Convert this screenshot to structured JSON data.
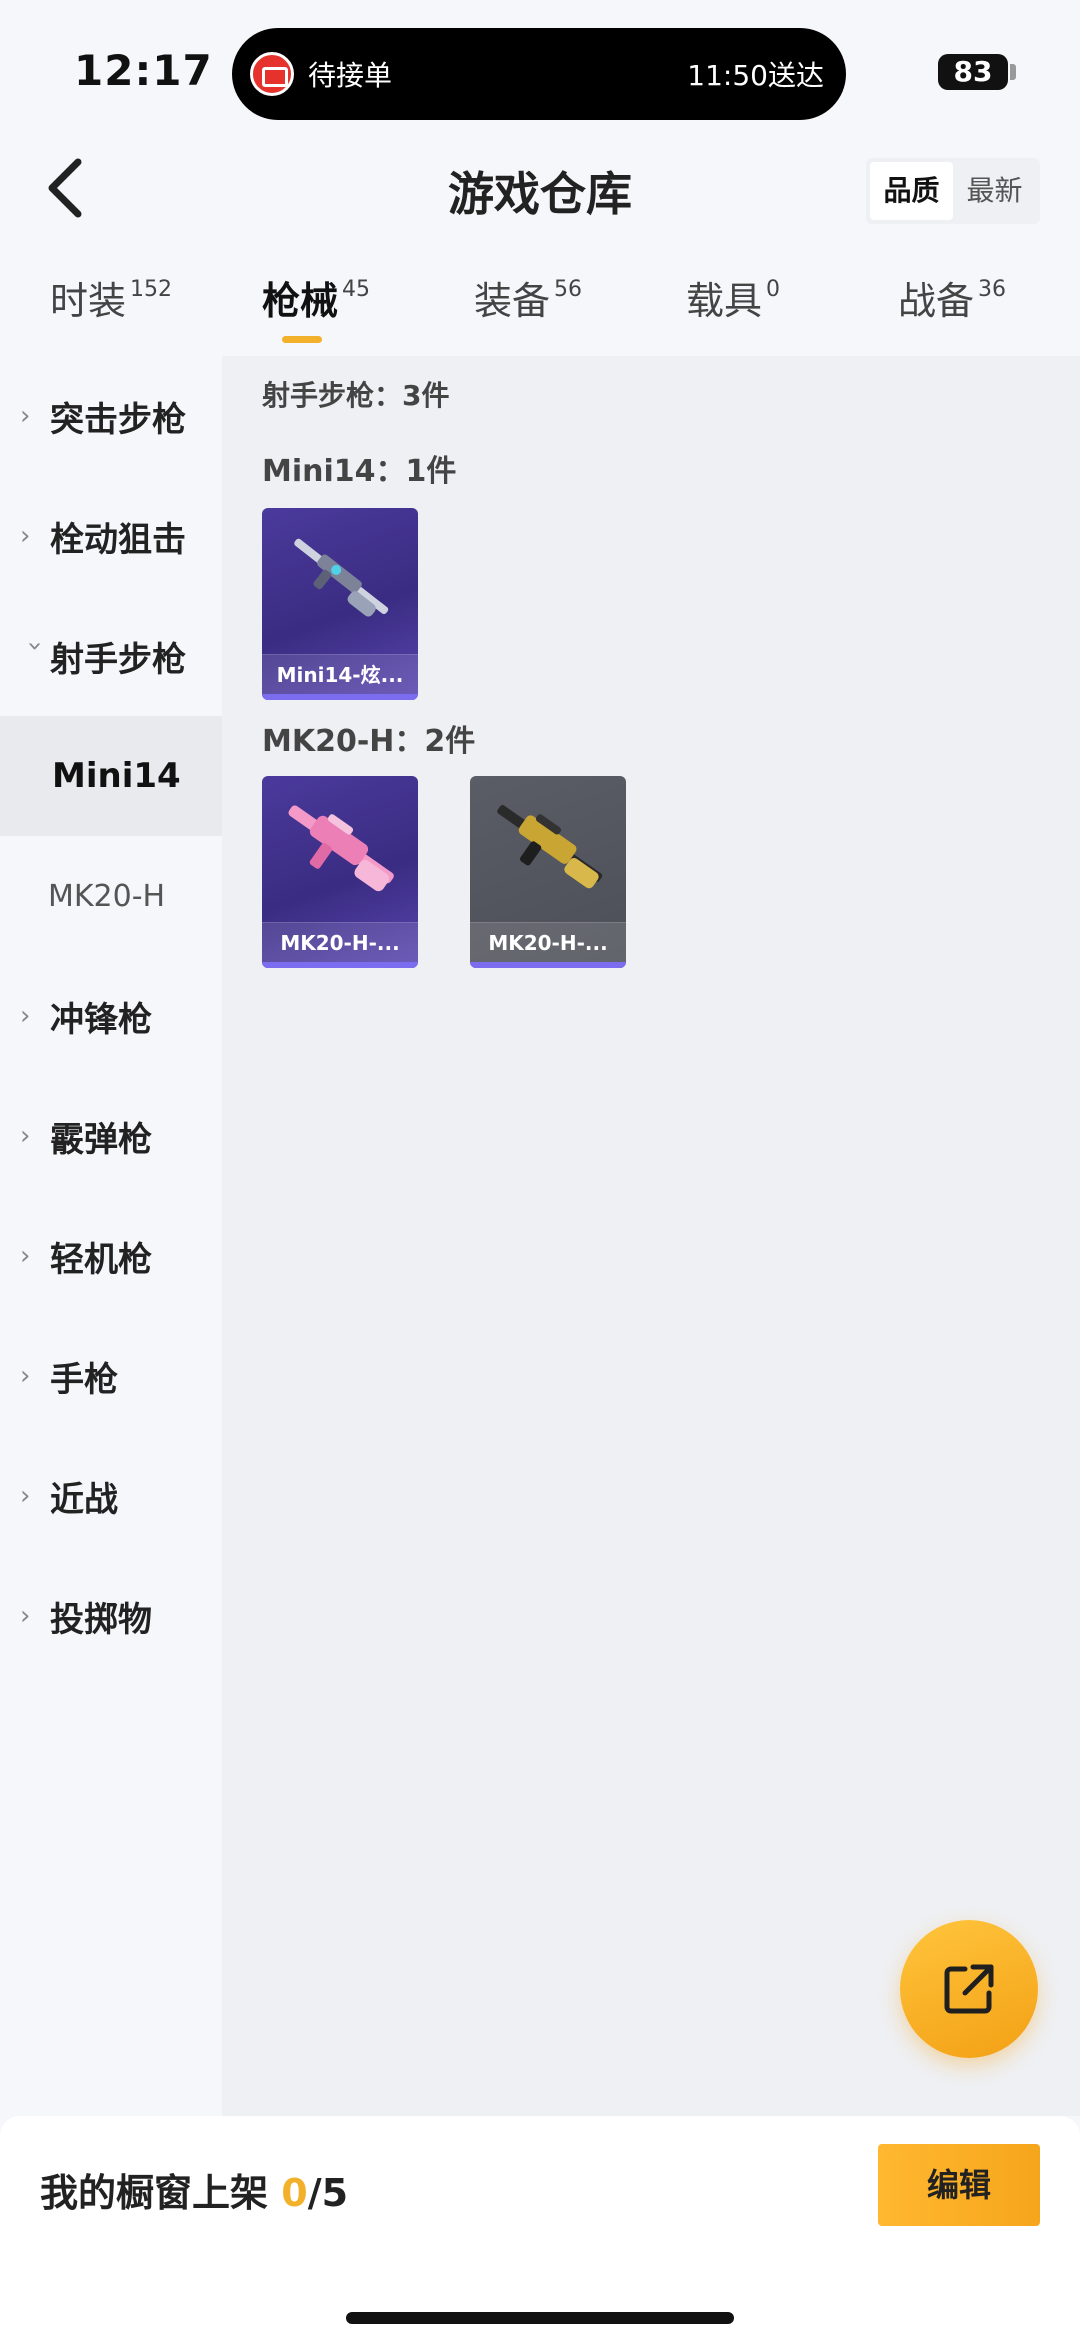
{
  "status_bar": {
    "time": "12:17",
    "island_left": "待接单",
    "island_right": "11:50送达",
    "battery": "83"
  },
  "header": {
    "title": "游戏仓库",
    "sort_options": [
      "品质",
      "最新"
    ],
    "sort_active": "品质"
  },
  "tabs": [
    {
      "label": "时装",
      "count": "152"
    },
    {
      "label": "枪械",
      "count": "45"
    },
    {
      "label": "装备",
      "count": "56"
    },
    {
      "label": "载具",
      "count": "0"
    },
    {
      "label": "战备",
      "count": "36"
    }
  ],
  "active_tab": "枪械",
  "sidebar": {
    "items": [
      {
        "label": "突击步枪",
        "expanded": false
      },
      {
        "label": "栓动狙击",
        "expanded": false
      },
      {
        "label": "射手步枪",
        "expanded": true
      },
      {
        "label": "Mini14",
        "sub": true,
        "active": true
      },
      {
        "label": "MK20-H",
        "sub": true,
        "active": false
      },
      {
        "label": "冲锋枪",
        "expanded": false
      },
      {
        "label": "霰弹枪",
        "expanded": false
      },
      {
        "label": "轻机枪",
        "expanded": false
      },
      {
        "label": "手枪",
        "expanded": false
      },
      {
        "label": "近战",
        "expanded": false
      },
      {
        "label": "投掷物",
        "expanded": false
      }
    ]
  },
  "content": {
    "category_title": "射手步枪：3件",
    "groups": [
      {
        "title": "Mini14：1件",
        "items": [
          {
            "label": "Mini14-炫...",
            "rarity_color": "#4b3a9c"
          }
        ]
      },
      {
        "title": "MK20-H：2件",
        "items": [
          {
            "label": "MK20-H-...",
            "rarity_color": "#4b3a9c"
          },
          {
            "label": "MK20-H-...",
            "rarity_color": "#5b5d66"
          }
        ]
      }
    ]
  },
  "bottom_bar": {
    "label": "我的橱窗上架 ",
    "count": "0",
    "total": "/5",
    "edit_label": "编辑"
  },
  "colors": {
    "accent": "#f3b02a",
    "purple_card": "#4b3a9c",
    "grey_card": "#5b5d66"
  }
}
